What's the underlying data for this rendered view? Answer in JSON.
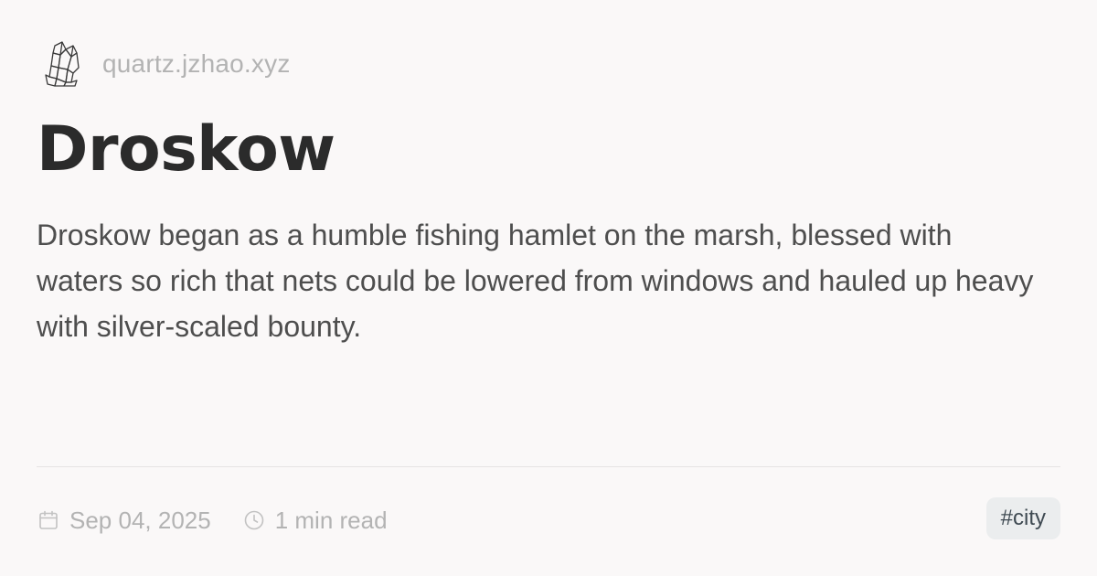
{
  "site": {
    "name": "quartz.jzhao.xyz",
    "logo_icon": "crystal-icon"
  },
  "page": {
    "title": "Droskow",
    "description": "Droskow began as a humble fishing hamlet on the marsh, blessed with waters so rich that nets could be lowered from windows and hauled up heavy with silver-scaled bounty."
  },
  "meta": {
    "date": "Sep 04, 2025",
    "date_icon": "calendar-icon",
    "read_time": "1 min read",
    "read_time_icon": "clock-icon"
  },
  "tags": [
    "#city"
  ],
  "colors": {
    "background": "#faf8f8",
    "title": "#2b2b2b",
    "body_text": "#4e4e4e",
    "muted_text": "#b3b3b3",
    "tag_background": "#ebedee",
    "tag_text": "#3f4a52"
  }
}
